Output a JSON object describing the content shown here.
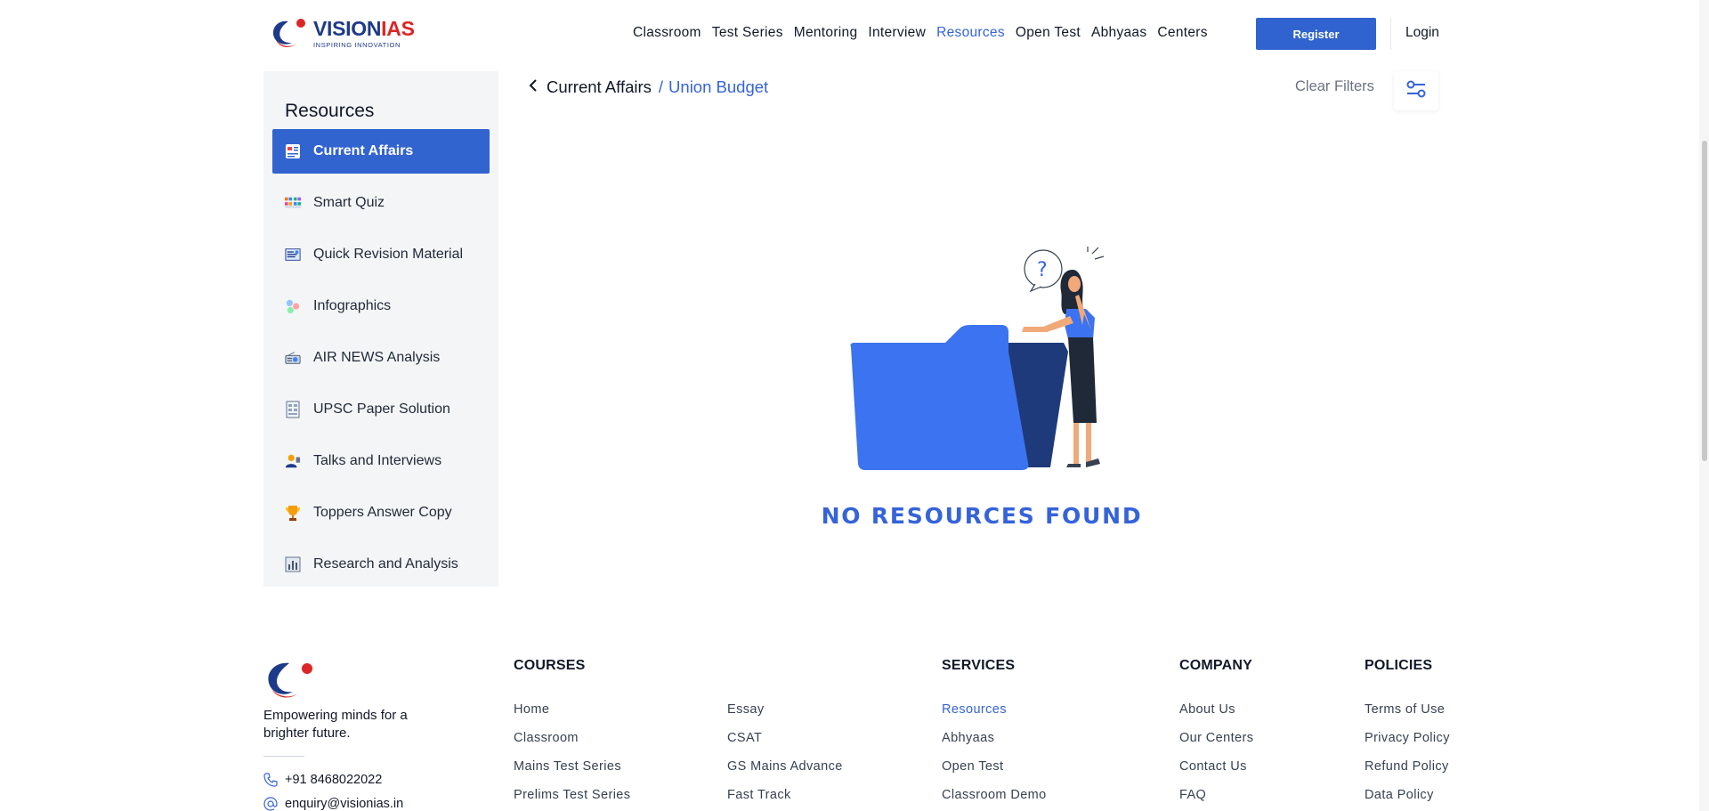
{
  "brand": {
    "name_part1": "VISION",
    "name_part2": "IAS",
    "tagline": "INSPIRING INNOVATION",
    "colors": {
      "primary": "#3063cf",
      "logo_blue": "#1e3a8a",
      "logo_red": "#dc2626"
    }
  },
  "nav": {
    "items": [
      "Classroom",
      "Test Series",
      "Mentoring",
      "Interview",
      "Resources",
      "Open Test",
      "Abhyaas",
      "Centers"
    ],
    "active": "Resources",
    "register_label": "Register",
    "login_label": "Login"
  },
  "sidebar": {
    "title": "Resources",
    "items": [
      {
        "label": "Current Affairs",
        "icon": "newspaper-icon",
        "active": true
      },
      {
        "label": "Smart Quiz",
        "icon": "quiz-grid-icon",
        "active": false
      },
      {
        "label": "Quick Revision Material",
        "icon": "revision-icon",
        "active": false
      },
      {
        "label": "Infographics",
        "icon": "infographics-icon",
        "active": false
      },
      {
        "label": "AIR NEWS Analysis",
        "icon": "radio-icon",
        "active": false
      },
      {
        "label": "UPSC Paper Solution",
        "icon": "paper-icon",
        "active": false
      },
      {
        "label": "Talks and Interviews",
        "icon": "speaker-icon",
        "active": false
      },
      {
        "label": "Toppers Answer Copy",
        "icon": "trophy-icon",
        "active": false
      },
      {
        "label": "Research and Analysis",
        "icon": "chart-icon",
        "active": false
      }
    ]
  },
  "breadcrumb": {
    "current": "Current Affairs",
    "separator": "/",
    "last": "Union Budget"
  },
  "filters": {
    "clear_label": "Clear Filters",
    "icon": "sliders-icon"
  },
  "empty_state": {
    "message": "NO RESOURCES FOUND",
    "illustration_icon": "empty-folder-icon"
  },
  "footer": {
    "tagline": "Empowering minds for a brighter future.",
    "phone": "+91 8468022022",
    "email": "enquiry@visionias.in",
    "courses_heading": "COURSES",
    "courses_col1": [
      "Home",
      "Classroom",
      "Mains Test Series",
      "Prelims Test Series"
    ],
    "courses_col2": [
      "Essay",
      "CSAT",
      "GS Mains Advance",
      "Fast Track"
    ],
    "services_heading": "SERVICES",
    "services": [
      "Resources",
      "Abhyaas",
      "Open Test",
      "Classroom Demo"
    ],
    "company_heading": "COMPANY",
    "company": [
      "About Us",
      "Our Centers",
      "Contact Us",
      "FAQ"
    ],
    "policies_heading": "POLICIES",
    "policies": [
      "Terms of Use",
      "Privacy Policy",
      "Refund Policy",
      "Data Policy"
    ]
  }
}
